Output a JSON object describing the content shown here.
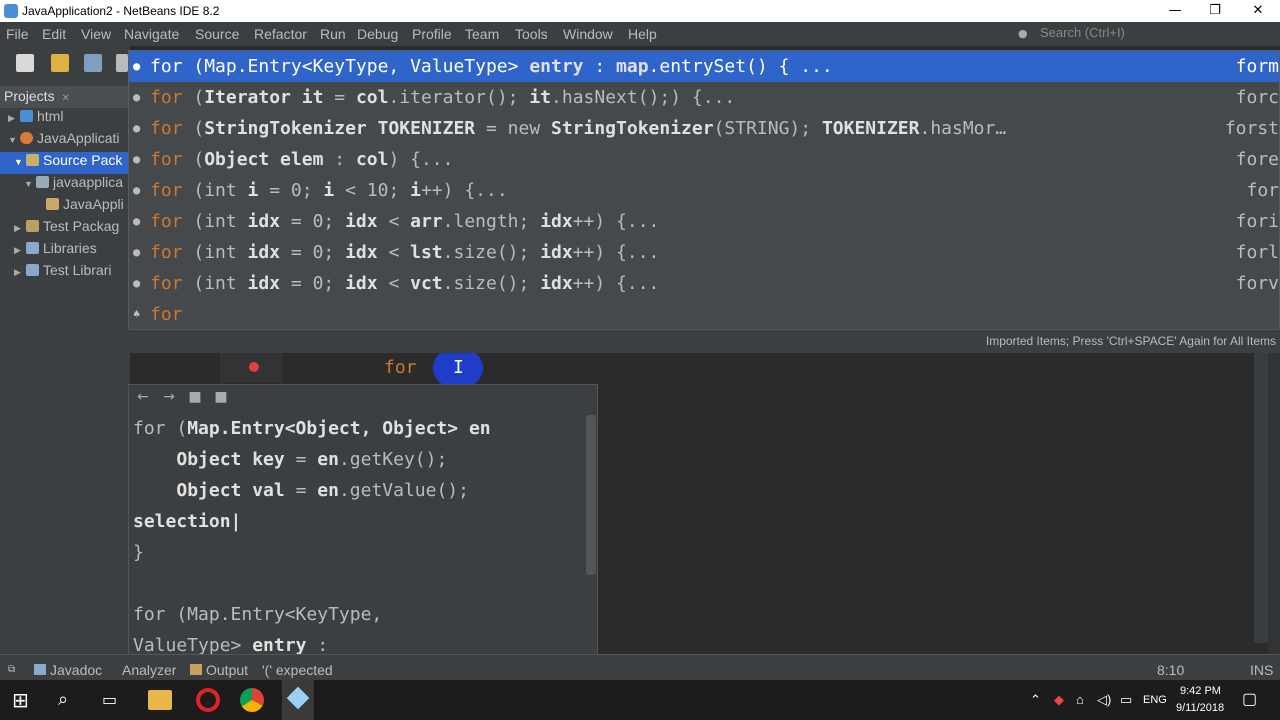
{
  "window": {
    "title": "JavaApplication2 - NetBeans IDE 8.2",
    "minimize": "—",
    "maximize": "❐",
    "close": "✕"
  },
  "menu": {
    "items": [
      "File",
      "Edit",
      "View",
      "Navigate",
      "Source",
      "Refactor",
      "Run",
      "Debug",
      "Profile",
      "Team",
      "Tools",
      "Window",
      "Help"
    ],
    "search_placeholder": "Search (Ctrl+I)"
  },
  "projects": {
    "tab_label": "Projects",
    "tab_close": "✕",
    "tree": [
      {
        "label": "html",
        "level": 0,
        "arrow": "▶"
      },
      {
        "label": "JavaApplicati",
        "level": 0,
        "arrow": "▼"
      },
      {
        "label": "Source Pack",
        "level": 1,
        "arrow": "▼",
        "selected": true
      },
      {
        "label": "javaapplica",
        "level": 2,
        "arrow": "▼"
      },
      {
        "label": "JavaAppli",
        "level": 3,
        "arrow": ""
      },
      {
        "label": "Test Packag",
        "level": 1,
        "arrow": "▶"
      },
      {
        "label": "Libraries",
        "level": 1,
        "arrow": "▶"
      },
      {
        "label": "Test Librari",
        "level": 1,
        "arrow": "▶"
      }
    ]
  },
  "completion": {
    "items": [
      {
        "segments": [
          [
            "kw",
            "for "
          ],
          [
            "t",
            "(Map.Entry<KeyType, ValueType> "
          ],
          [
            "b",
            "entry"
          ],
          [
            "t",
            " : "
          ],
          [
            "b",
            "map"
          ],
          [
            "t",
            ".entrySet() { ..."
          ]
        ],
        "abbr": "form",
        "selected": true
      },
      {
        "segments": [
          [
            "kw",
            "for "
          ],
          [
            "t",
            "("
          ],
          [
            "b",
            "Iterator it"
          ],
          [
            "t",
            " = "
          ],
          [
            "b",
            "col"
          ],
          [
            "t",
            ".iterator(); "
          ],
          [
            "b",
            "it"
          ],
          [
            "t",
            ".hasNext();) {..."
          ]
        ],
        "abbr": "forc"
      },
      {
        "segments": [
          [
            "kw",
            "for "
          ],
          [
            "t",
            "("
          ],
          [
            "b",
            "StringTokenizer TOKENIZER"
          ],
          [
            "t",
            " = new "
          ],
          [
            "b",
            "StringTokenizer"
          ],
          [
            "t",
            "(STRING); "
          ],
          [
            "b",
            "TOKENIZER"
          ],
          [
            "t",
            ".hasMor…"
          ]
        ],
        "abbr": "forst"
      },
      {
        "segments": [
          [
            "kw",
            "for "
          ],
          [
            "t",
            "("
          ],
          [
            "b",
            "Object elem"
          ],
          [
            "t",
            " : "
          ],
          [
            "b",
            "col"
          ],
          [
            "t",
            ") {..."
          ]
        ],
        "abbr": "fore"
      },
      {
        "segments": [
          [
            "kw",
            "for "
          ],
          [
            "t",
            "(int "
          ],
          [
            "b",
            "i"
          ],
          [
            "t",
            " = 0; "
          ],
          [
            "b",
            "i"
          ],
          [
            "t",
            " < 10; "
          ],
          [
            "b",
            "i"
          ],
          [
            "t",
            "++) {..."
          ]
        ],
        "abbr": "for"
      },
      {
        "segments": [
          [
            "kw",
            "for "
          ],
          [
            "t",
            "(int "
          ],
          [
            "b",
            "idx"
          ],
          [
            "t",
            " = 0; "
          ],
          [
            "b",
            "idx"
          ],
          [
            "t",
            " < "
          ],
          [
            "b",
            "arr"
          ],
          [
            "t",
            ".length; "
          ],
          [
            "b",
            "idx"
          ],
          [
            "t",
            "++) {..."
          ]
        ],
        "abbr": "fori"
      },
      {
        "segments": [
          [
            "kw",
            "for "
          ],
          [
            "t",
            "(int "
          ],
          [
            "b",
            "idx"
          ],
          [
            "t",
            " = 0; "
          ],
          [
            "b",
            "idx"
          ],
          [
            "t",
            " < "
          ],
          [
            "b",
            "lst"
          ],
          [
            "t",
            ".size(); "
          ],
          [
            "b",
            "idx"
          ],
          [
            "t",
            "++) {..."
          ]
        ],
        "abbr": "forl"
      },
      {
        "segments": [
          [
            "kw",
            "for "
          ],
          [
            "t",
            "(int "
          ],
          [
            "b",
            "idx"
          ],
          [
            "t",
            " = 0; "
          ],
          [
            "b",
            "idx"
          ],
          [
            "t",
            " < "
          ],
          [
            "b",
            "vct"
          ],
          [
            "t",
            ".size(); "
          ],
          [
            "b",
            "idx"
          ],
          [
            "t",
            "++) {..."
          ]
        ],
        "abbr": "forv"
      },
      {
        "segments": [
          [
            "kw",
            "for"
          ]
        ],
        "abbr": "",
        "keyword": true
      }
    ],
    "status": "Imported Items; Press 'Ctrl+SPACE' Again for All Items"
  },
  "editor": {
    "typed": "for",
    "ibeam": "I"
  },
  "doc": {
    "lines": [
      [
        [
          "t",
          "for ("
        ],
        [
          "b",
          "Map.Entry<Object, Object> en"
        ]
      ],
      [
        [
          "t",
          "    "
        ],
        [
          "b",
          "Object key"
        ],
        [
          "t",
          " = "
        ],
        [
          "b",
          "en"
        ],
        [
          "t",
          ".getKey();"
        ]
      ],
      [
        [
          "t",
          "    "
        ],
        [
          "b",
          "Object val"
        ],
        [
          "t",
          " = "
        ],
        [
          "b",
          "en"
        ],
        [
          "t",
          ".getValue();"
        ]
      ],
      [
        [
          "b",
          "selection|"
        ]
      ],
      [
        [
          "t",
          "}"
        ]
      ],
      [
        [
          "t",
          ""
        ]
      ],
      [
        [
          "t",
          "for (Map.Entry<KeyType,"
        ]
      ],
      [
        [
          "t",
          "ValueType> "
        ],
        [
          "b",
          "entry"
        ],
        [
          "t",
          " :"
        ]
      ]
    ]
  },
  "statusbar": {
    "javadoc": "Javadoc",
    "analyzer": "Analyzer",
    "output": "Output",
    "message": "'(' expected",
    "position": "8:10",
    "mode": "INS"
  },
  "taskbar": {
    "time": "9:42 PM",
    "date": "9/11/2018",
    "lang": "ENG"
  },
  "colors": {
    "selection": "#2f65ca",
    "keyword": "#cc7832",
    "background": "#2b2b2b",
    "panel": "#3c3f41"
  }
}
